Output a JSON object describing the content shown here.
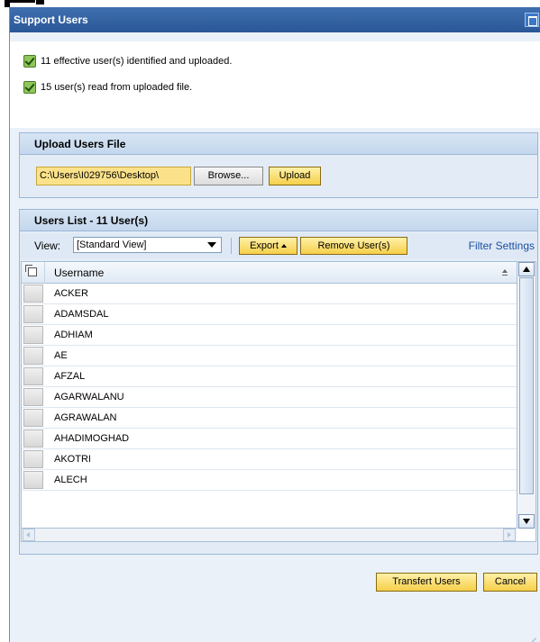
{
  "dialog": {
    "title": "Support Users"
  },
  "messages": [
    {
      "text": "11 effective user(s) identified and uploaded.",
      "status": "success"
    },
    {
      "text": "15 user(s) read from uploaded file.",
      "status": "success"
    }
  ],
  "upload": {
    "heading": "Upload Users File",
    "file_value": "C:\\Users\\I029756\\Desktop\\",
    "browse_label": "Browse...",
    "upload_label": "Upload"
  },
  "users_list": {
    "heading": "Users List - 11 User(s)",
    "view_label": "View:",
    "view_selected": "[Standard View]",
    "export_label": "Export",
    "remove_label": "Remove User(s)",
    "filter_label": "Filter Settings",
    "column_header": "Username",
    "rows": [
      "ACKER",
      "ADAMSDAL",
      "ADHIAM",
      "AE",
      "AFZAL",
      "AGARWALANU",
      "AGRAWALAN",
      "AHADIMOGHAD",
      "AKOTRI",
      "ALECH"
    ]
  },
  "footer": {
    "transfer_label": "Transfert Users",
    "cancel_label": "Cancel"
  },
  "colors": {
    "titlebar": "#2b5797",
    "success": "#8fc65a",
    "highlight_button": "#f6cf4a",
    "panel_bg": "#e3ecf6"
  }
}
